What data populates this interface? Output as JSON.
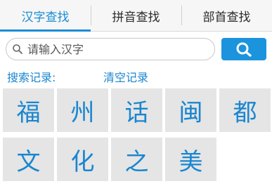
{
  "tabs": [
    {
      "label": "汉字查找",
      "active": true
    },
    {
      "label": "拼音查找",
      "active": false
    },
    {
      "label": "部首查找",
      "active": false
    }
  ],
  "search": {
    "placeholder": "请输入汉字",
    "value": "",
    "button_icon": "search-icon"
  },
  "history": {
    "label": "搜索记录:",
    "clear_label": "清空记录",
    "items": [
      "福",
      "州",
      "话",
      "闽",
      "都",
      "文",
      "化",
      "之",
      "美"
    ]
  },
  "colors": {
    "accent": "#1a8dd6",
    "search_button": "#1b93dd",
    "cell_background": "#e5e5e5",
    "char_text": "#1a86d0"
  }
}
